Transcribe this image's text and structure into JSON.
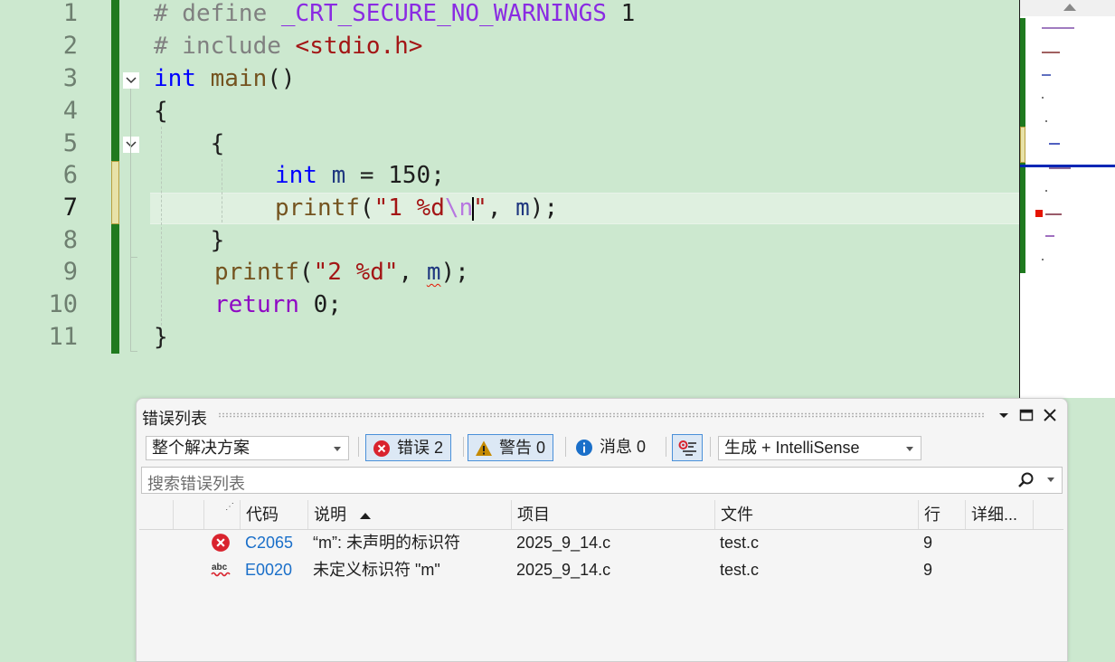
{
  "editor": {
    "line_numbers": [
      "1",
      "2",
      "3",
      "4",
      "5",
      "6",
      "7",
      "8",
      "9",
      "10",
      "11"
    ],
    "current_line": "7",
    "lines": {
      "l1": {
        "a": "# define ",
        "b": "_CRT_SECURE_NO_WARNINGS",
        "c": " 1"
      },
      "l2": {
        "a": "# include ",
        "b": "<stdio.h>"
      },
      "l3": {
        "a": "int",
        "b": " ",
        "c": "main",
        "d": "()"
      },
      "l4": {
        "a": "{"
      },
      "l5": {
        "a": "    {"
      },
      "l6": {
        "a": "int",
        "b": " ",
        "c": "m",
        "d": " = 150;"
      },
      "l7": {
        "a": "printf",
        "b": "(",
        "c": "\"1 %d",
        "d": "\\n",
        "e": "\"",
        "f": ", ",
        "g": "m",
        "h": ");"
      },
      "l8": {
        "a": "    }"
      },
      "l9": {
        "a": "printf",
        "b": "(",
        "c": "\"2 %d\"",
        "d": ", ",
        "e": "m",
        "f": ");"
      },
      "l10": {
        "a": "return",
        "b": " 0;"
      },
      "l11": {
        "a": "}"
      }
    }
  },
  "error_list": {
    "title": "错误列表",
    "scope_dropdown": "整个解决方案",
    "errors_btn": "错误 2",
    "warnings_btn": "警告 0",
    "messages_btn": "消息 0",
    "build_dropdown": "生成 + IntelliSense",
    "search_placeholder": "搜索错误列表",
    "columns": {
      "code": "代码",
      "desc": "说明",
      "project": "项目",
      "file": "文件",
      "line": "行",
      "details": "详细..."
    },
    "rows": [
      {
        "icon": "error-icon",
        "code": "C2065",
        "desc": "“m”: 未声明的标识符",
        "project": "2025_9_14.c",
        "file": "test.c",
        "line": "9"
      },
      {
        "icon": "intellisense-squiggle-icon",
        "code": "E0020",
        "desc": "未定义标识符 \"m\"",
        "project": "2025_9_14.c",
        "file": "test.c",
        "line": "9"
      }
    ]
  },
  "colors": {
    "editor_bg": "#cce8cf",
    "error_red": "#d9232e",
    "warning_amber": "#c58a00",
    "info_blue": "#1a6fc9"
  }
}
